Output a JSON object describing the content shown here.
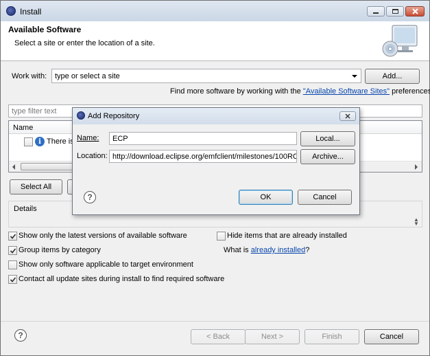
{
  "window": {
    "title": "Install",
    "banner_title": "Available Software",
    "banner_subtitle": "Select a site or enter the location of a site."
  },
  "work_with": {
    "label": "Work with:",
    "combo_value": "type or select a site",
    "add_button": "Add...",
    "find_more_prefix": "Find more software by working with the ",
    "find_more_link": "\"Available Software Sites\"",
    "find_more_suffix": " preferences."
  },
  "filter": {
    "placeholder": "type filter text"
  },
  "table": {
    "header_name": "Name",
    "row_text": "There is"
  },
  "buttons": {
    "select_all": "Select All"
  },
  "details": {
    "label": "Details"
  },
  "options": [
    {
      "label": "Show only the latest versions of available software",
      "checked": true
    },
    {
      "label": "Group items by category",
      "checked": true
    },
    {
      "label": "Show only software applicable to target environment",
      "checked": false
    },
    {
      "label": "Contact all update sites during install to find required software",
      "checked": true
    }
  ],
  "options_right": {
    "hide_installed": "Hide items that are already installed",
    "hide_installed_checked": false,
    "what_is_prefix": "What is ",
    "what_is_link": "already installed",
    "what_is_suffix": "?"
  },
  "footer": {
    "back": "< Back",
    "next": "Next >",
    "finish": "Finish",
    "cancel": "Cancel"
  },
  "dialog": {
    "title": "Add Repository",
    "name_label": "Name:",
    "name_value": "ECP",
    "location_label": "Location:",
    "location_value": "http://download.eclipse.org/emfclient/milestones/100RC",
    "local_button": "Local...",
    "archive_button": "Archive...",
    "ok": "OK",
    "cancel": "Cancel"
  },
  "icons": {
    "window_icon": "eclipse-icon",
    "banner_image": "monitor-cd-icon",
    "info_icon": "info-icon",
    "help_icon": "help-icon"
  }
}
